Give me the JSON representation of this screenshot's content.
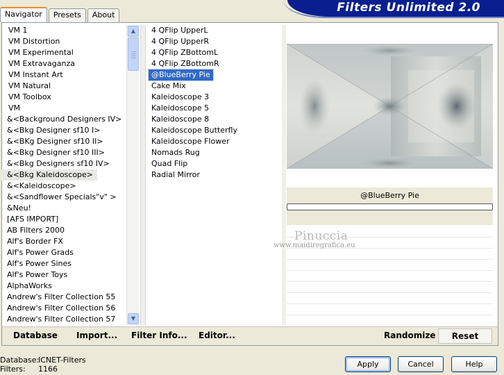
{
  "tabs": [
    {
      "label": "Navigator",
      "active": true
    },
    {
      "label": "Presets",
      "active": false
    },
    {
      "label": "About",
      "active": false
    }
  ],
  "banner": {
    "title": "Filters Unlimited 2.0"
  },
  "categories": [
    "VM 1",
    "VM Distortion",
    "VM Experimental",
    "VM Extravaganza",
    "VM Instant Art",
    "VM Natural",
    "VM Toolbox",
    "VM",
    "&<Background Designers IV>",
    "&<Bkg Designer sf10 I>",
    "&<BKg Designer sf10 II>",
    "&<Bkg Designer sf10 III>",
    "&<Bkg Designers sf10 IV>",
    "&<Bkg Kaleidoscope>",
    "&<Kaleidoscope>",
    "&<Sandflower Specials\"v\" >",
    "&Neu!",
    "[AFS IMPORT]",
    "AB Filters 2000",
    "Alf's Border FX",
    "Alf's Power Grads",
    "Alf's Power Sines",
    "Alf's Power Toys",
    "AlphaWorks",
    "Andrew's Filter Collection 55",
    "Andrew's Filter Collection 56",
    "Andrew's Filter Collection 57"
  ],
  "selected_category": "&<Bkg Kaleidoscope>",
  "filters": [
    "4 QFlip UpperL",
    "4 QFlip UpperR",
    "4 QFlip ZBottomL",
    "4 QFlip ZBottomR",
    "@BlueBerry Pie",
    "Cake Mix",
    "Kaleidoscope 3",
    "Kaleidoscope 5",
    "Kaleidoscope 8",
    "Kaleidoscope Butterfly",
    "Kaleidoscope Flower",
    "Nomads Rug",
    "Quad Flip",
    "Radial Mirror"
  ],
  "selected_filter": "@BlueBerry Pie",
  "preview": {
    "filter_name": "@BlueBerry Pie",
    "progress": 0
  },
  "watermark": {
    "name": "Pinuccia",
    "url": "www.maidiregrafica.eu"
  },
  "bottom_bar": {
    "database": "Database",
    "import": "Import...",
    "filter_info": "Filter Info...",
    "editor": "Editor...",
    "randomize": "Randomize",
    "reset": "Reset"
  },
  "status": {
    "database_label": "Database:",
    "database_value": "ICNET-Filters",
    "filters_label": "Filters:",
    "filters_value": "1166"
  },
  "dialog_buttons": {
    "apply": "Apply",
    "cancel": "Cancel",
    "help": "Help"
  }
}
